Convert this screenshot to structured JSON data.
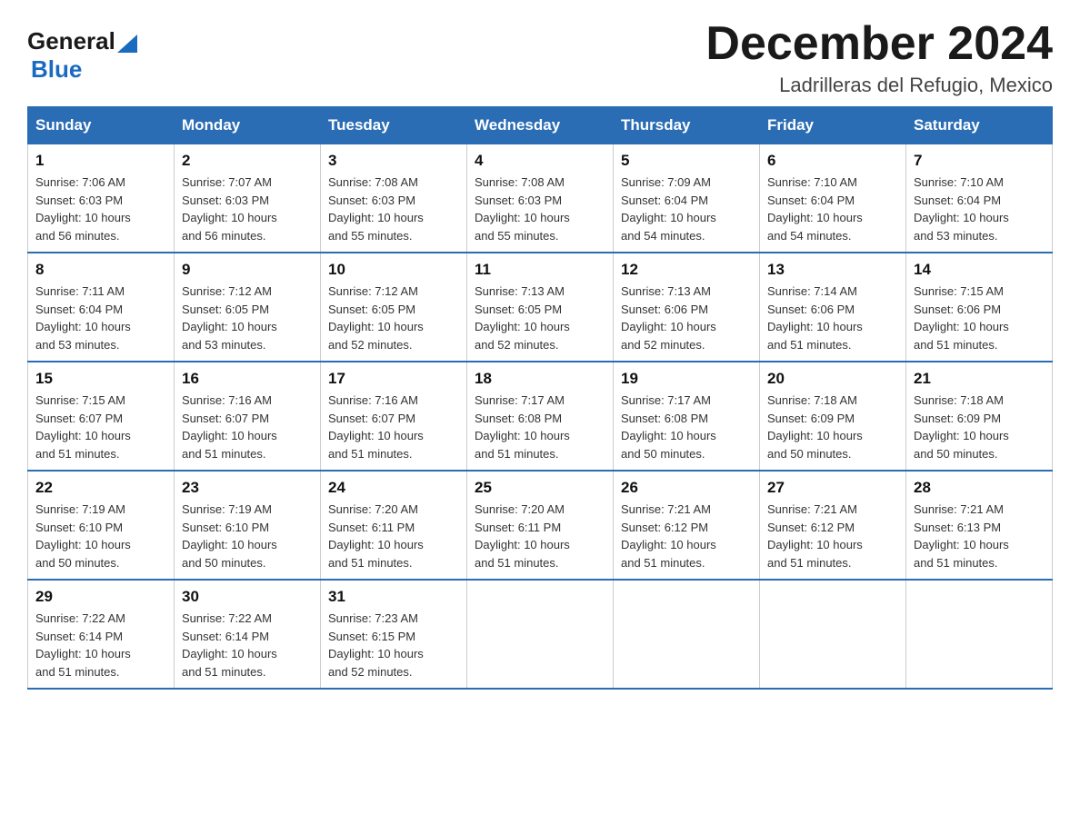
{
  "logo": {
    "general": "General",
    "blue": "Blue",
    "triangle": "▲"
  },
  "title": "December 2024",
  "subtitle": "Ladrilleras del Refugio, Mexico",
  "days_of_week": [
    "Sunday",
    "Monday",
    "Tuesday",
    "Wednesday",
    "Thursday",
    "Friday",
    "Saturday"
  ],
  "weeks": [
    [
      {
        "day": "1",
        "info": "Sunrise: 7:06 AM\nSunset: 6:03 PM\nDaylight: 10 hours\nand 56 minutes."
      },
      {
        "day": "2",
        "info": "Sunrise: 7:07 AM\nSunset: 6:03 PM\nDaylight: 10 hours\nand 56 minutes."
      },
      {
        "day": "3",
        "info": "Sunrise: 7:08 AM\nSunset: 6:03 PM\nDaylight: 10 hours\nand 55 minutes."
      },
      {
        "day": "4",
        "info": "Sunrise: 7:08 AM\nSunset: 6:03 PM\nDaylight: 10 hours\nand 55 minutes."
      },
      {
        "day": "5",
        "info": "Sunrise: 7:09 AM\nSunset: 6:04 PM\nDaylight: 10 hours\nand 54 minutes."
      },
      {
        "day": "6",
        "info": "Sunrise: 7:10 AM\nSunset: 6:04 PM\nDaylight: 10 hours\nand 54 minutes."
      },
      {
        "day": "7",
        "info": "Sunrise: 7:10 AM\nSunset: 6:04 PM\nDaylight: 10 hours\nand 53 minutes."
      }
    ],
    [
      {
        "day": "8",
        "info": "Sunrise: 7:11 AM\nSunset: 6:04 PM\nDaylight: 10 hours\nand 53 minutes."
      },
      {
        "day": "9",
        "info": "Sunrise: 7:12 AM\nSunset: 6:05 PM\nDaylight: 10 hours\nand 53 minutes."
      },
      {
        "day": "10",
        "info": "Sunrise: 7:12 AM\nSunset: 6:05 PM\nDaylight: 10 hours\nand 52 minutes."
      },
      {
        "day": "11",
        "info": "Sunrise: 7:13 AM\nSunset: 6:05 PM\nDaylight: 10 hours\nand 52 minutes."
      },
      {
        "day": "12",
        "info": "Sunrise: 7:13 AM\nSunset: 6:06 PM\nDaylight: 10 hours\nand 52 minutes."
      },
      {
        "day": "13",
        "info": "Sunrise: 7:14 AM\nSunset: 6:06 PM\nDaylight: 10 hours\nand 51 minutes."
      },
      {
        "day": "14",
        "info": "Sunrise: 7:15 AM\nSunset: 6:06 PM\nDaylight: 10 hours\nand 51 minutes."
      }
    ],
    [
      {
        "day": "15",
        "info": "Sunrise: 7:15 AM\nSunset: 6:07 PM\nDaylight: 10 hours\nand 51 minutes."
      },
      {
        "day": "16",
        "info": "Sunrise: 7:16 AM\nSunset: 6:07 PM\nDaylight: 10 hours\nand 51 minutes."
      },
      {
        "day": "17",
        "info": "Sunrise: 7:16 AM\nSunset: 6:07 PM\nDaylight: 10 hours\nand 51 minutes."
      },
      {
        "day": "18",
        "info": "Sunrise: 7:17 AM\nSunset: 6:08 PM\nDaylight: 10 hours\nand 51 minutes."
      },
      {
        "day": "19",
        "info": "Sunrise: 7:17 AM\nSunset: 6:08 PM\nDaylight: 10 hours\nand 50 minutes."
      },
      {
        "day": "20",
        "info": "Sunrise: 7:18 AM\nSunset: 6:09 PM\nDaylight: 10 hours\nand 50 minutes."
      },
      {
        "day": "21",
        "info": "Sunrise: 7:18 AM\nSunset: 6:09 PM\nDaylight: 10 hours\nand 50 minutes."
      }
    ],
    [
      {
        "day": "22",
        "info": "Sunrise: 7:19 AM\nSunset: 6:10 PM\nDaylight: 10 hours\nand 50 minutes."
      },
      {
        "day": "23",
        "info": "Sunrise: 7:19 AM\nSunset: 6:10 PM\nDaylight: 10 hours\nand 50 minutes."
      },
      {
        "day": "24",
        "info": "Sunrise: 7:20 AM\nSunset: 6:11 PM\nDaylight: 10 hours\nand 51 minutes."
      },
      {
        "day": "25",
        "info": "Sunrise: 7:20 AM\nSunset: 6:11 PM\nDaylight: 10 hours\nand 51 minutes."
      },
      {
        "day": "26",
        "info": "Sunrise: 7:21 AM\nSunset: 6:12 PM\nDaylight: 10 hours\nand 51 minutes."
      },
      {
        "day": "27",
        "info": "Sunrise: 7:21 AM\nSunset: 6:12 PM\nDaylight: 10 hours\nand 51 minutes."
      },
      {
        "day": "28",
        "info": "Sunrise: 7:21 AM\nSunset: 6:13 PM\nDaylight: 10 hours\nand 51 minutes."
      }
    ],
    [
      {
        "day": "29",
        "info": "Sunrise: 7:22 AM\nSunset: 6:14 PM\nDaylight: 10 hours\nand 51 minutes."
      },
      {
        "day": "30",
        "info": "Sunrise: 7:22 AM\nSunset: 6:14 PM\nDaylight: 10 hours\nand 51 minutes."
      },
      {
        "day": "31",
        "info": "Sunrise: 7:23 AM\nSunset: 6:15 PM\nDaylight: 10 hours\nand 52 minutes."
      },
      {
        "day": "",
        "info": ""
      },
      {
        "day": "",
        "info": ""
      },
      {
        "day": "",
        "info": ""
      },
      {
        "day": "",
        "info": ""
      }
    ]
  ]
}
